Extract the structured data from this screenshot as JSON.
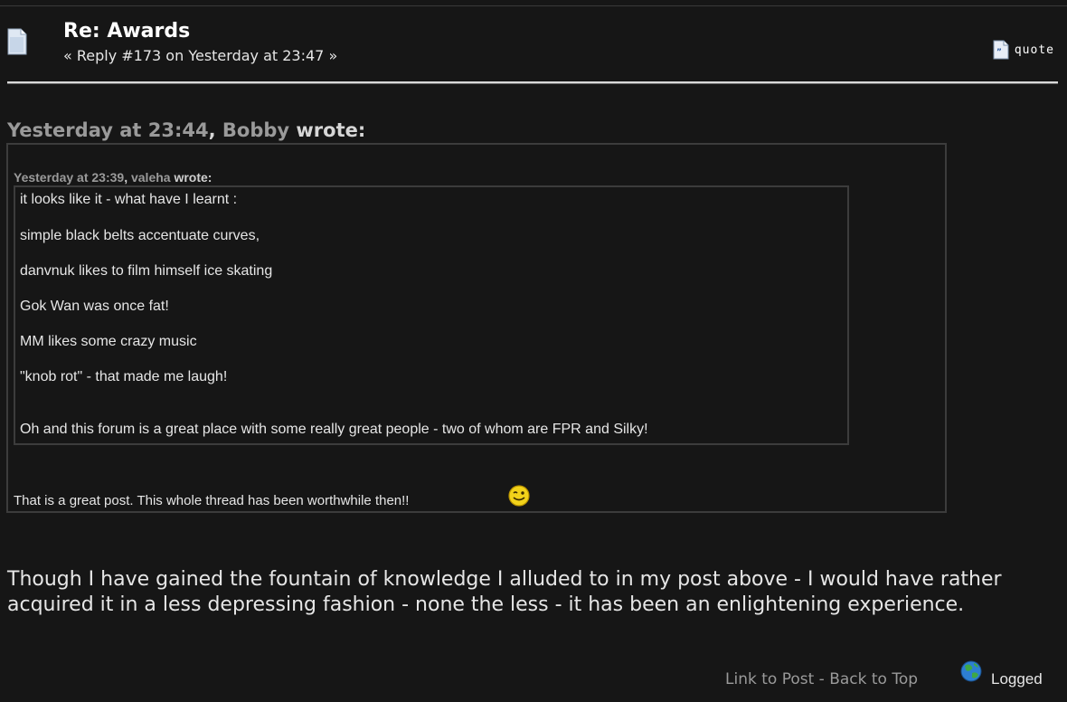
{
  "post": {
    "title": "Re: Awards",
    "meta": "« Reply #173 on Yesterday at 23:47 »",
    "quote_label": "quote"
  },
  "outer_quote": {
    "time": "Yesterday at 23:44",
    "sep": ", ",
    "author": "Bobby",
    "wrote": " wrote:",
    "reply": "That is a great post. This whole thread has been worthwhile then!!"
  },
  "inner_quote": {
    "time": "Yesterday at 23:39",
    "sep": ", ",
    "author": "valeha",
    "wrote": " wrote:",
    "lines": [
      "it looks like it - what have I learnt :",
      "simple black belts accentuate curves,",
      "danvnuk likes to film himself ice skating",
      "Gok Wan was once fat!",
      "MM likes some crazy music",
      "\"knob rot\" - that made me laugh!",
      "Oh and this forum is a great place with some really great people - two of whom are FPR and Silky!"
    ]
  },
  "body": "Though I have gained the fountain of knowledge I alluded to in my post above - I would have rather acquired it in a less depressing fashion - none the less - it has been an enlightening experience.",
  "footer": {
    "link_to_post": "Link to Post",
    "separator": " - ",
    "back_to_top": "Back to Top",
    "logged": "Logged"
  },
  "icons": {
    "post": "page-icon",
    "quote": "quote-icon",
    "smiley": "wink-smiley-icon",
    "logged": "globe-icon"
  }
}
